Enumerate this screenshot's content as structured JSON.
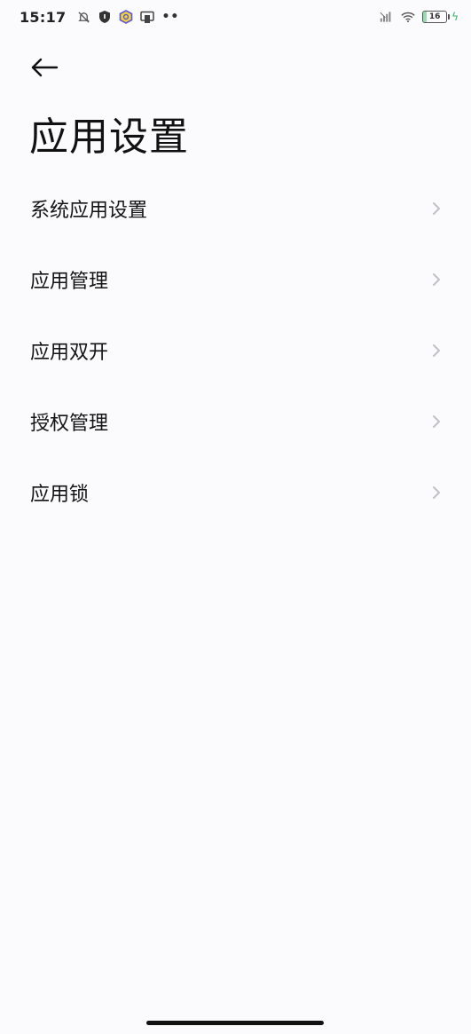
{
  "status_bar": {
    "time": "15:17",
    "battery_level": "16",
    "left_icons": [
      "silent-icon",
      "shield-icon",
      "hexagon-app-icon",
      "cast-icon"
    ],
    "more_indicator": "••",
    "right_icons": [
      "signal-icon",
      "wifi-icon",
      "battery-icon",
      "charging-icon"
    ]
  },
  "header": {
    "back_icon": "back-arrow-icon",
    "title": "应用设置"
  },
  "menu": {
    "items": [
      {
        "label": "系统应用设置"
      },
      {
        "label": "应用管理"
      },
      {
        "label": "应用双开"
      },
      {
        "label": "授权管理"
      },
      {
        "label": "应用锁"
      }
    ],
    "chevron_icon": "chevron-right-icon"
  },
  "colors": {
    "background": "#fbfafd",
    "battery_fill": "#43c36a",
    "charging": "#2eb860"
  }
}
